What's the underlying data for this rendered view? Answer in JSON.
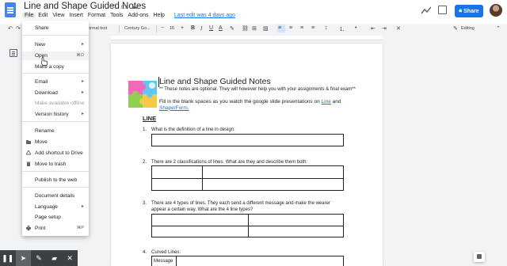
{
  "app": {
    "title": "Line and Shape Guided Notes",
    "menu": [
      "File",
      "Edit",
      "View",
      "Insert",
      "Format",
      "Tools",
      "Add-ons",
      "Help"
    ],
    "last_edit": "Last edit was 4 days ago",
    "share_label": "Share",
    "colors": {
      "accent": "#1a73e8",
      "doc_icon": "#4285f4"
    }
  },
  "toolbar": {
    "style": "Normal text",
    "font": "Century Go...",
    "font_size": "16",
    "editing_label": "Editing",
    "icons": [
      "undo-icon",
      "redo-icon",
      "bold-icon",
      "italic-icon",
      "underline-icon",
      "text-color-icon",
      "highlight-icon",
      "link-icon",
      "comment-icon",
      "image-icon",
      "align-left-icon",
      "align-center-icon",
      "align-right-icon",
      "justify-icon",
      "line-spacing-icon",
      "numbered-list-icon",
      "bulleted-list-icon",
      "indent-icon",
      "clear-format-icon",
      "pencil-icon",
      "expand-icon"
    ]
  },
  "file_menu": {
    "items": [
      {
        "label": "Share",
        "shortcut": "",
        "submenu": false,
        "disabled": false,
        "icon": ""
      },
      {
        "label": "New",
        "shortcut": "",
        "submenu": true,
        "disabled": false,
        "icon": ""
      },
      {
        "label": "Open",
        "shortcut": "⌘O",
        "submenu": false,
        "disabled": false,
        "icon": ""
      },
      {
        "label": "Make a copy",
        "shortcut": "",
        "submenu": false,
        "disabled": false,
        "icon": ""
      },
      {
        "label": "Email",
        "shortcut": "",
        "submenu": true,
        "disabled": false,
        "icon": ""
      },
      {
        "label": "Download",
        "shortcut": "",
        "submenu": true,
        "disabled": false,
        "icon": ""
      },
      {
        "label": "Make available offline",
        "shortcut": "",
        "submenu": false,
        "disabled": true,
        "icon": ""
      },
      {
        "label": "Version history",
        "shortcut": "",
        "submenu": true,
        "disabled": false,
        "icon": ""
      },
      {
        "label": "Rename",
        "shortcut": "",
        "submenu": false,
        "disabled": false,
        "icon": ""
      },
      {
        "label": "Move",
        "shortcut": "",
        "submenu": false,
        "disabled": false,
        "icon": "folder-icon"
      },
      {
        "label": "Add shortcut to Drive",
        "shortcut": "",
        "submenu": false,
        "disabled": false,
        "icon": "drive-shortcut-icon"
      },
      {
        "label": "Move to trash",
        "shortcut": "",
        "submenu": false,
        "disabled": false,
        "icon": "trash-icon"
      },
      {
        "label": "Publish to the web",
        "shortcut": "",
        "submenu": false,
        "disabled": false,
        "icon": ""
      },
      {
        "label": "Document details",
        "shortcut": "",
        "submenu": false,
        "disabled": false,
        "icon": ""
      },
      {
        "label": "Language",
        "shortcut": "",
        "submenu": true,
        "disabled": false,
        "icon": ""
      },
      {
        "label": "Page setup",
        "shortcut": "",
        "submenu": false,
        "disabled": false,
        "icon": ""
      },
      {
        "label": "Print",
        "shortcut": "⌘P",
        "submenu": false,
        "disabled": false,
        "icon": "print-icon"
      }
    ]
  },
  "document": {
    "heading": "Line and Shape Guided Notes",
    "note": "** These notes are optional.  They will however help you with your assignments  & final exam**",
    "fill_text_prefix": "Fill in the blank spaces as you watch the google slide presentations on ",
    "link_line": "Line",
    "fill_text_and": " and ",
    "link_shape": "Shape/Form.",
    "section": "LINE",
    "q1_num": "1.",
    "q1": "What is the definition of a line in design:",
    "q2_num": "2.",
    "q2": "There are 2 classifications of lines.  What are they and describe them both:",
    "q3_num": "3.",
    "q3_line1": "There are 4 types of lines.  They each send a different message and make the wearer",
    "q3_line2": "appear a certain way.  What are the 4 line types?",
    "q4_num": "4.",
    "q4": "Curved Lines:",
    "q4_cell": "Message"
  },
  "annotation_bar": {
    "tools": [
      "pause-icon",
      "pointer-icon",
      "pen-icon",
      "highlighter-icon",
      "close-icon"
    ]
  }
}
